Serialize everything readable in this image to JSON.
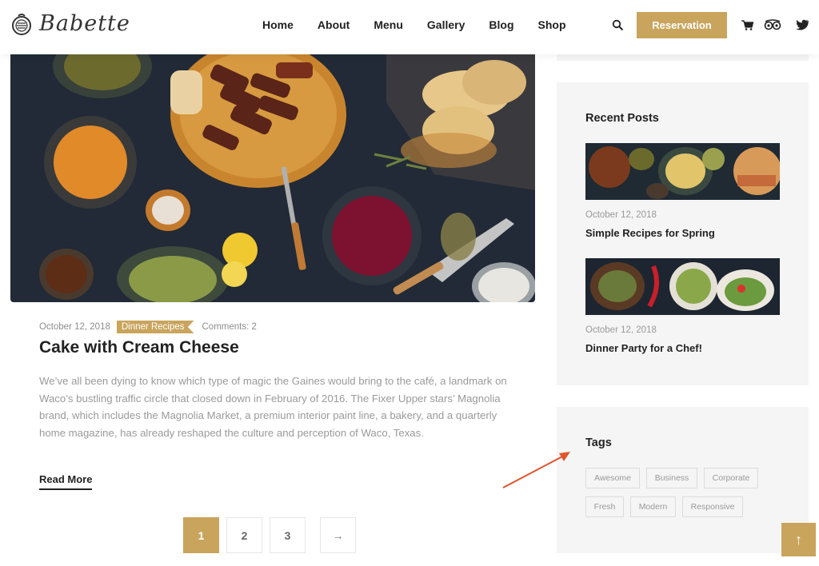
{
  "header": {
    "logo_text": "Babette",
    "nav": [
      "Home",
      "About",
      "Menu",
      "Gallery",
      "Blog",
      "Shop"
    ],
    "reservation_label": "Reservation",
    "icons": [
      "search-icon",
      "cart-icon",
      "tripadvisor-icon",
      "twitter-icon"
    ]
  },
  "post": {
    "date": "October 12, 2018",
    "category": "Dinner Recipes",
    "comments": "Comments: 2",
    "title": "Cake with Cream Cheese",
    "excerpt": "We’ve all been dying to know which type of magic the Gaines would bring to the café, a landmark on Waco’s bustling traffic circle that closed down in February of 2016. The Fixer Upper stars’ Magnolia brand, which includes the Magnolia Market, a premium interior paint line, a bakery, and a quarterly home magazine, has already reshaped the culture and perception of Waco, Texas.",
    "read_more": "Read More"
  },
  "pagination": {
    "pages": [
      "1",
      "2",
      "3"
    ],
    "next": "→"
  },
  "sidebar": {
    "recent_title": "Recent Posts",
    "recent": [
      {
        "date": "October 12, 2018",
        "title": "Simple Recipes for Spring"
      },
      {
        "date": "October 12, 2018",
        "title": "Dinner Party for a Chef!"
      }
    ],
    "tags_title": "Tags",
    "tags": [
      "Awesome",
      "Business",
      "Corporate",
      "Fresh",
      "Modern",
      "Responsive"
    ]
  },
  "colors": {
    "accent": "#c9a45c",
    "annotation_arrow": "#e0552b"
  },
  "back_to_top": "↑"
}
